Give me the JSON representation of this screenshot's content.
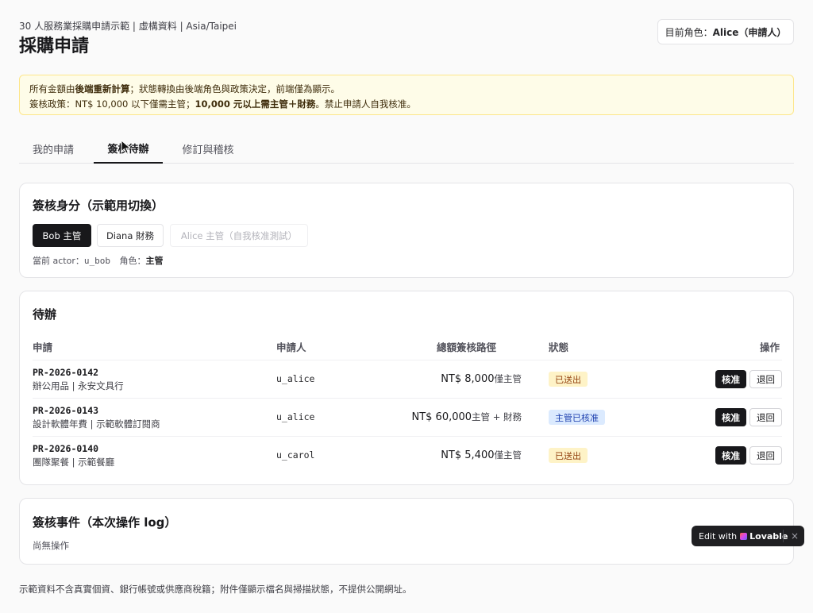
{
  "header": {
    "subtitle": "30 人服務業採購申請示範 | 虛構資料 | Asia/Taipei",
    "title": "採購申請",
    "role_prefix": "目前角色：",
    "role_name": "Alice（申請人）"
  },
  "notice": {
    "line1": [
      {
        "text": "所有金額由",
        "bold": false
      },
      {
        "text": "後端重新計算",
        "bold": true
      },
      {
        "text": "；狀態轉換由後端角色與政策決定，前端僅為顯示。",
        "bold": false
      }
    ],
    "line2": [
      {
        "text": "簽核政策：NT$ 10,000 以下僅需主管；",
        "bold": false
      },
      {
        "text": "10,000 元以上需主管＋財務",
        "bold": true
      },
      {
        "text": "。禁止申請人自我核准。",
        "bold": false
      }
    ]
  },
  "tabs": [
    {
      "label": "我的申請",
      "active": false
    },
    {
      "label": "簽核待辦",
      "active": true
    },
    {
      "label": "修訂與稽核",
      "active": false
    }
  ],
  "actor_card": {
    "title": "簽核身分（示範用切換）",
    "buttons": [
      {
        "label": "Bob 主管",
        "state": "selected"
      },
      {
        "label": "Diana 財務",
        "state": "normal"
      },
      {
        "label": "Alice 主管（自我核准測試）",
        "state": "disabled"
      }
    ],
    "info_prefix": "當前 actor：",
    "actor_id": "u_bob",
    "role_prefix": "角色：",
    "role": "主管"
  },
  "todo_card": {
    "title": "待辦",
    "headers": {
      "request": "申請",
      "requester": "申請人",
      "amount_path": "總額簽核路徑",
      "status": "狀態",
      "actions": "操作"
    },
    "rows": [
      {
        "id": "PR-2026-0142",
        "desc": "辦公用品 | 永安文具行",
        "requester": "u_alice",
        "amount": "NT$ 8,000",
        "path": "僅主管",
        "status": "已送出",
        "status_color": "yellow"
      },
      {
        "id": "PR-2026-0143",
        "desc": "設計軟體年費 | 示範軟體訂閱商",
        "requester": "u_alice",
        "amount": "NT$ 60,000",
        "path": "主管 + 財務",
        "status": "主管已核准",
        "status_color": "blue"
      },
      {
        "id": "PR-2026-0140",
        "desc": "團隊聚餐 | 示範餐廳",
        "requester": "u_carol",
        "amount": "NT$ 5,400",
        "path": "僅主管",
        "status": "已送出",
        "status_color": "yellow"
      }
    ],
    "approve_label": "核准",
    "return_label": "退回"
  },
  "log_card": {
    "title": "簽核事件（本次操作 log）",
    "empty": "尚無操作"
  },
  "footer_note": "示範資料不含真實個資、銀行帳號或供應商稅籍；附件僅顯示檔名與掃描狀態，不提供公開網址。",
  "lovable": {
    "prefix": "Edit with",
    "brand": "Lovable",
    "close": "×"
  },
  "icons": {
    "cursor": "cursor-arrow-icon",
    "close": "close-icon",
    "lovable_logo": "lovable-heart-icon"
  }
}
